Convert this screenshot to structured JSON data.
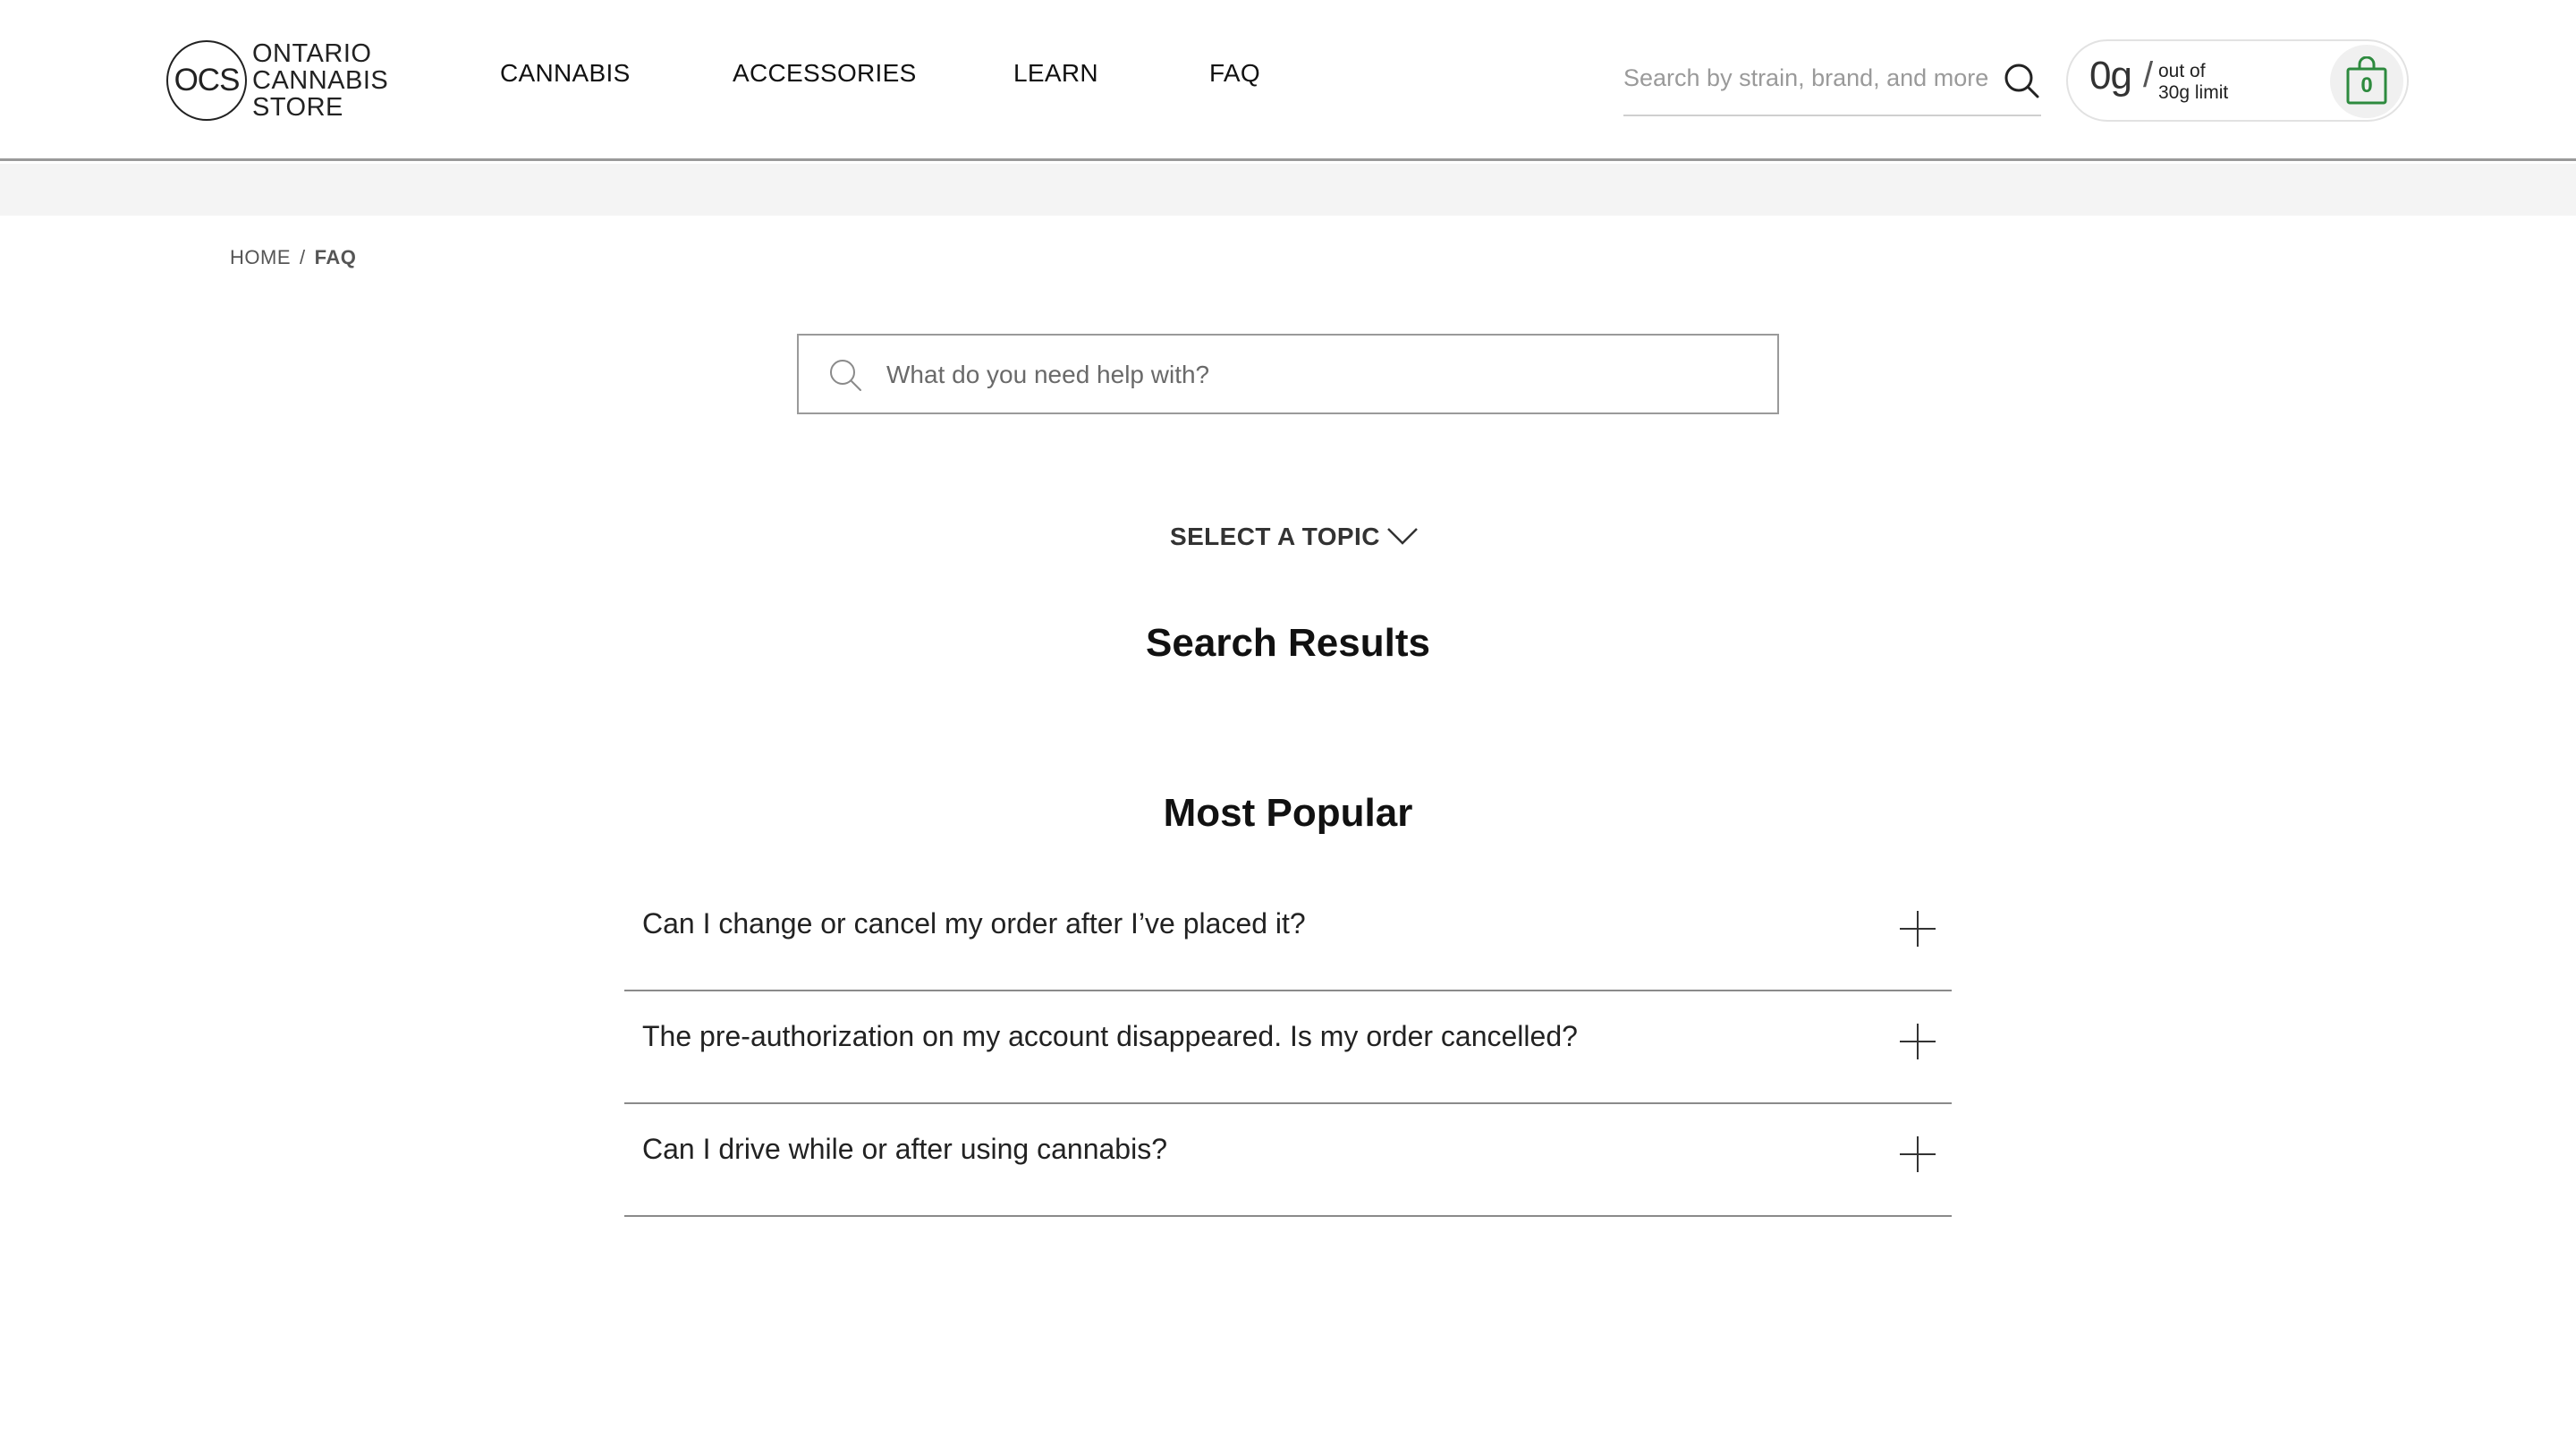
{
  "header": {
    "logo": {
      "mark": "OCS",
      "lines": [
        "ONTARIO",
        "CANNABIS",
        "STORE"
      ]
    },
    "nav": [
      "CANNABIS",
      "ACCESSORIES",
      "LEARN",
      "FAQ"
    ],
    "search": {
      "placeholder": "Search by strain, brand, and more",
      "icon": "search-icon"
    },
    "cart": {
      "amount": "0g",
      "slash": "/",
      "limit_line1": "out of",
      "limit_line2": "30g limit",
      "count": "0",
      "icon": "shopping-bag-icon",
      "accent_color": "#2d8a3e"
    }
  },
  "breadcrumb": {
    "home": "HOME",
    "separator": "/",
    "current": "FAQ"
  },
  "help_search": {
    "placeholder": "What do you need help with?",
    "icon": "search-icon"
  },
  "topic_select": {
    "label": "SELECT A TOPIC",
    "icon": "chevron-down-icon"
  },
  "sections": {
    "search_results": "Search Results",
    "most_popular": "Most Popular"
  },
  "faq": [
    {
      "question": "Can I change or cancel my order after I’ve placed it?",
      "icon": "plus-icon"
    },
    {
      "question": "The pre-authorization on my account disappeared. Is my order cancelled?",
      "icon": "plus-icon"
    },
    {
      "question": "Can I drive while or after using cannabis?",
      "icon": "plus-icon"
    }
  ]
}
